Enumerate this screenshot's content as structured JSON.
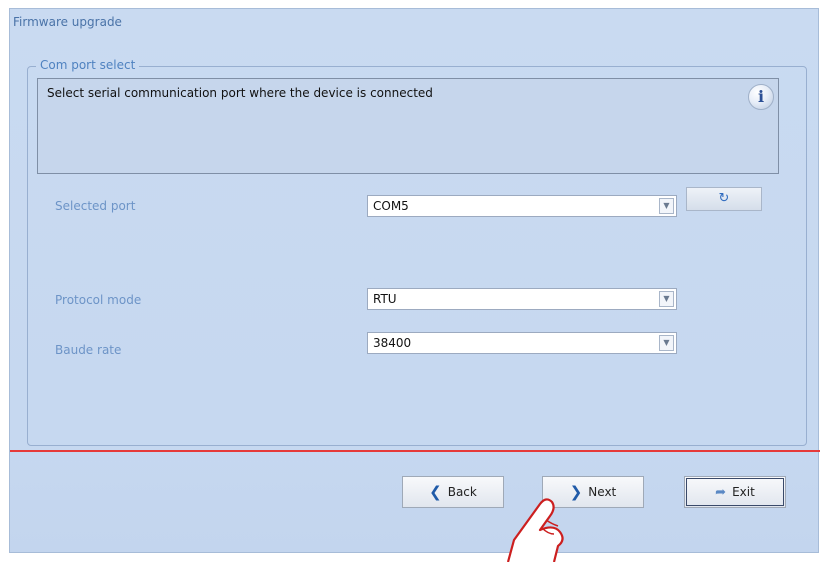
{
  "window": {
    "title": "Firmware upgrade"
  },
  "group": {
    "legend": "Com port select"
  },
  "info": {
    "text": "Select serial communication  port where the device is connected",
    "icon": "info-icon"
  },
  "fields": {
    "selected_port": {
      "label": "Selected port",
      "value": "COM5"
    },
    "protocol_mode": {
      "label": "Protocol mode",
      "value": "RTU"
    },
    "baud_rate": {
      "label": "Baude rate",
      "value": "38400"
    }
  },
  "buttons": {
    "back": "Back",
    "next": "Next",
    "exit": "Exit",
    "refresh_icon": "refresh-icon"
  },
  "colors": {
    "accent_line": "#e63a3a",
    "label_blue": "#6d94c7"
  }
}
